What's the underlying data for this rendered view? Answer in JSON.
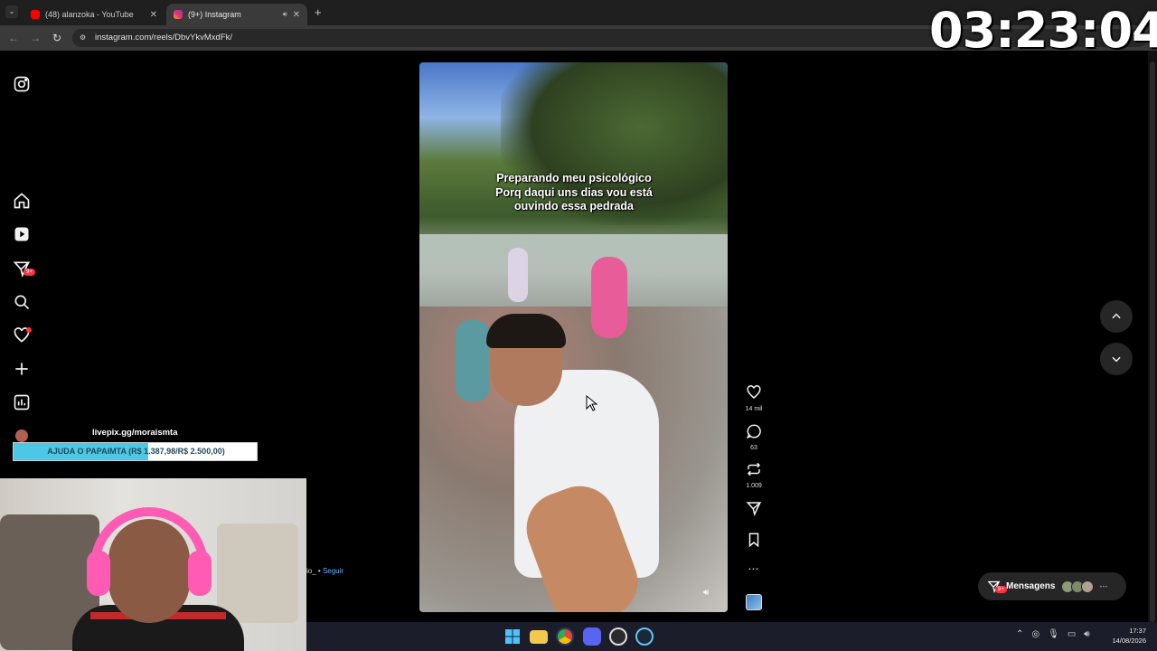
{
  "browser": {
    "tabs": [
      {
        "title": "(48) alanzoka - YouTube",
        "active": false,
        "favicon_color": "#ff0000"
      },
      {
        "title": "(9+) Instagram",
        "active": true,
        "favicon_color": "#e1306c"
      }
    ],
    "new_tab_symbol": "+",
    "url": "instagram.com/reels/DbvYkvMxdFk/"
  },
  "stream_overlay": {
    "clock": "03:23:04",
    "livepix_label": "livepix.gg/moraismta",
    "donation_text": "AJUDA O PAPAIMTA (R$ 1.387,98/R$ 2.500,00)",
    "donation_progress": 0.555,
    "follow_fragment": "io_",
    "follow_separator": " • ",
    "follow_label": "Seguir"
  },
  "sidebar": {
    "notifications_badge": "9+"
  },
  "reel": {
    "caption": "Preparando meu psicológico Porq daqui uns dias vou está ouvindo essa pedrada"
  },
  "actions": {
    "likes": "14 mil",
    "comments": "63",
    "reposts": "1.009"
  },
  "messages": {
    "label": "Mensagens",
    "badge": "9+"
  },
  "taskbar": {
    "time": "17:37",
    "date": "14/08/2026"
  },
  "colors": {
    "accent_badge": "#ff3040",
    "link_blue": "#6ab0ff",
    "donation_fill": "#4cc7e6",
    "headset_pink": "#ff5ab4"
  }
}
